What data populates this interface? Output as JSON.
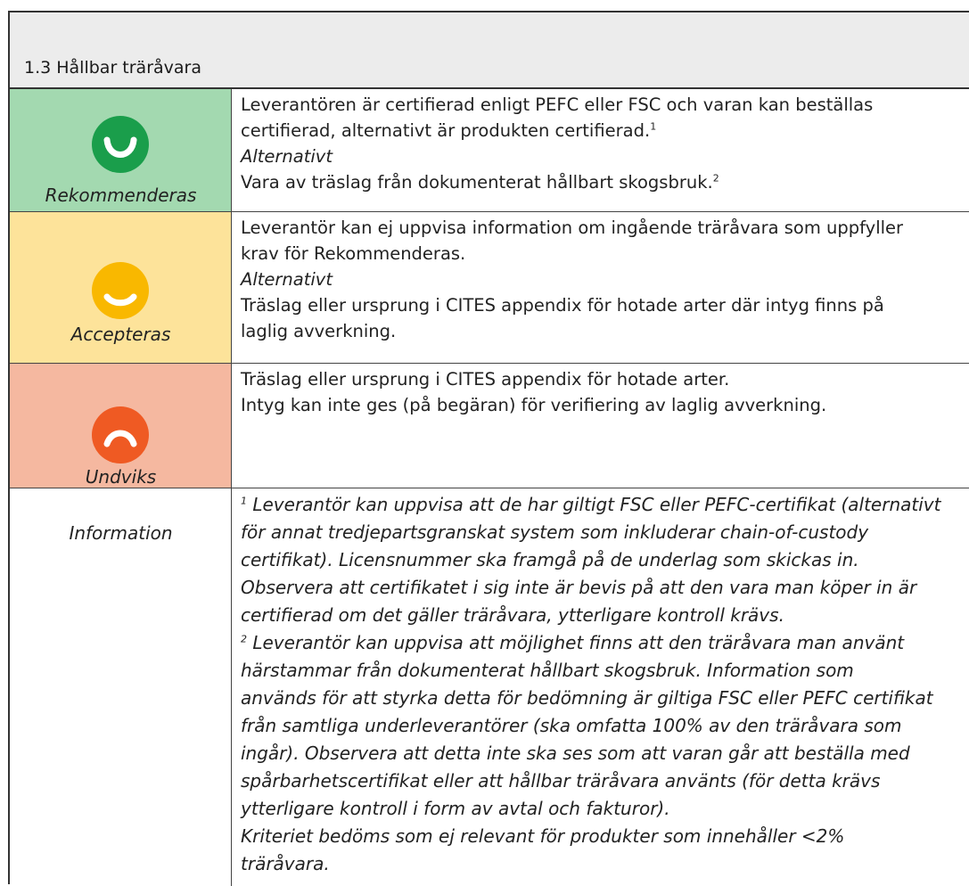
{
  "header": {
    "title": "1.3 Hållbar träråvara"
  },
  "colors": {
    "recommended_bg": "#a3d9b0",
    "accepted_bg": "#fde39a",
    "avoid_bg": "#f5b8a0",
    "recommended_face": "#1a9e4b",
    "accepted_face": "#f9b800",
    "avoid_face": "#ef5a23"
  },
  "levels": {
    "recommended": {
      "label": "Rekommenderas",
      "icon": "happy-face-icon",
      "line1": "Leverantören är certifierad enligt PEFC eller FSC och varan kan beställas",
      "line2": "certifierad, alternativt är produkten certifierad.",
      "line2_sup": "1",
      "alt": "Alternativt",
      "line3": "Vara av träslag från dokumenterat hållbart skogsbruk.",
      "line3_sup": "2"
    },
    "accepted": {
      "label": "Accepteras",
      "icon": "neutral-smile-face-icon",
      "line1": "Leverantör kan ej uppvisa information om ingående träråvara som uppfyller",
      "line2": "krav för Rekommenderas.",
      "alt": "Alternativt",
      "line3": "Träslag eller ursprung i CITES appendix för hotade arter där intyg finns på",
      "line4": "laglig avverkning."
    },
    "avoid": {
      "label": "Undviks",
      "icon": "sad-face-icon",
      "line1": "Träslag eller ursprung i CITES appendix för hotade arter.",
      "line2": "Intyg kan inte ges (på begäran) för verifiering av laglig avverkning."
    }
  },
  "information": {
    "label": "Information",
    "note1_sup": "1",
    "note1_lines": [
      "Leverantör kan uppvisa att de har giltigt FSC eller PEFC-certifikat (alternativt",
      "för annat tredjepartsgranskat system som inkluderar chain-of-custody",
      "certifikat). Licensnummer ska framgå på de underlag som skickas in.",
      "Observera att certifikatet i sig inte är bevis på att den vara man köper in är",
      "certifierad om det gäller träråvara, ytterligare kontroll krävs."
    ],
    "note2_sup": "2",
    "note2_lines": [
      "Leverantör kan uppvisa att möjlighet finns att den träråvara man använt",
      "härstammar från dokumenterat hållbart skogsbruk. Information som",
      "används för att styrka detta för bedömning är giltiga FSC eller PEFC certifikat",
      "från samtliga underleverantörer (ska omfatta 100% av den träråvara som",
      "ingår). Observera att detta inte ska ses som att varan går att beställa med",
      "spårbarhetscertifikat eller att hållbar träråvara använts (för detta krävs",
      "ytterligare kontroll i form av avtal och fakturor)."
    ],
    "note3_lines": [
      "Kriteriet bedöms som ej relevant för produkter som innehåller <2%",
      "träråvara."
    ]
  }
}
